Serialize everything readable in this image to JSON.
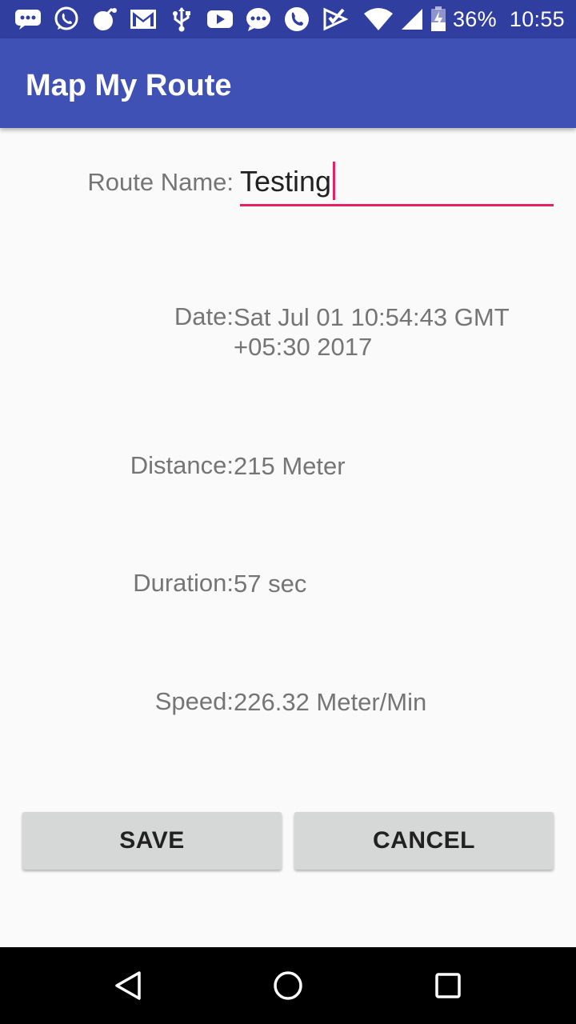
{
  "status_bar": {
    "battery_percent": "36%",
    "time": "10:55",
    "notification_icons": [
      "chat-bubble-icon",
      "whatsapp-icon",
      "bomb-icon",
      "gmail-icon",
      "usb-icon",
      "youtube-icon",
      "message-icon",
      "phone-icon",
      "checkbox-icon"
    ],
    "colors": {
      "background": "#303f9f"
    }
  },
  "app_bar": {
    "title": "Map My Route",
    "colors": {
      "background": "#3f51b5"
    }
  },
  "form": {
    "route_name_label": "Route Name:",
    "route_name_value": "Testing",
    "date_label": "Date:",
    "date_value": "Sat Jul 01 10:54:43 GMT +05:30 2017",
    "distance_label": "Distance:",
    "distance_value": "215 Meter",
    "duration_label": "Duration:",
    "duration_value": "57 sec",
    "speed_label": "Speed:",
    "speed_value": "226.32 Meter/Min",
    "accent_color": "#e91e63"
  },
  "buttons": {
    "save_label": "SAVE",
    "cancel_label": "CANCEL"
  },
  "nav_bar": {
    "icons": [
      "back-icon",
      "home-icon",
      "recents-icon"
    ]
  }
}
